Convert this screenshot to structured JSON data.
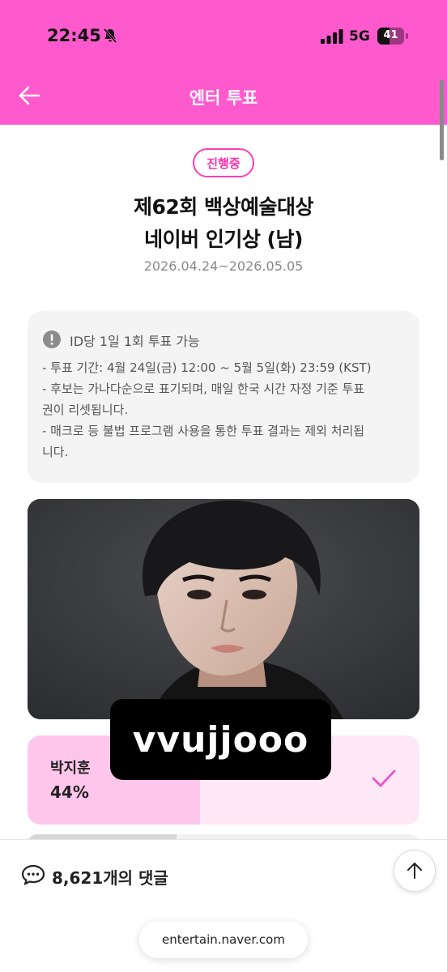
{
  "status_bar": {
    "time": "22:45",
    "network": "5G",
    "battery": "41"
  },
  "nav": {
    "title": "엔터 투표"
  },
  "vote": {
    "status_badge": "진행중",
    "title_line1": "제62회 백상예술대상",
    "title_line2": "네이버 인기상 (남)",
    "period": "2026.04.24~2026.05.05"
  },
  "notice": {
    "headline": "ID당 1일 1회 투표 가능",
    "lines": [
      "- 투표 기간: 4월 24일(금) 12:00 ~ 5월 5일(화) 23:59 (KST)",
      "- 후보는 가나다순으로 표기되며, 매일 한국 시간 자정 기준 투표",
      "권이 리셋됩니다.",
      "- 매크로 등 불법 프로그램 사용을 통한 투표 결과는 제외 처리됩",
      "니다."
    ]
  },
  "candidate": {
    "name": "박지훈",
    "percent": "44%",
    "share": 0.44,
    "voted": true
  },
  "watermark": "vvujjooo",
  "comments": {
    "label": "8,621개의 댓글"
  },
  "browser": {
    "url": "entertain.naver.com"
  },
  "colors": {
    "brand_pink": "#ff5acd",
    "badge_pink": "#ff2fae",
    "vote_fill": "#ffc6ec",
    "vote_bg": "#ffe8f6",
    "check": "#e85ad0"
  },
  "icons": [
    "bell-mute-icon",
    "signal-icon",
    "battery-icon",
    "back-arrow-icon",
    "info-icon",
    "check-icon",
    "comment-icon",
    "arrow-up-icon"
  ]
}
